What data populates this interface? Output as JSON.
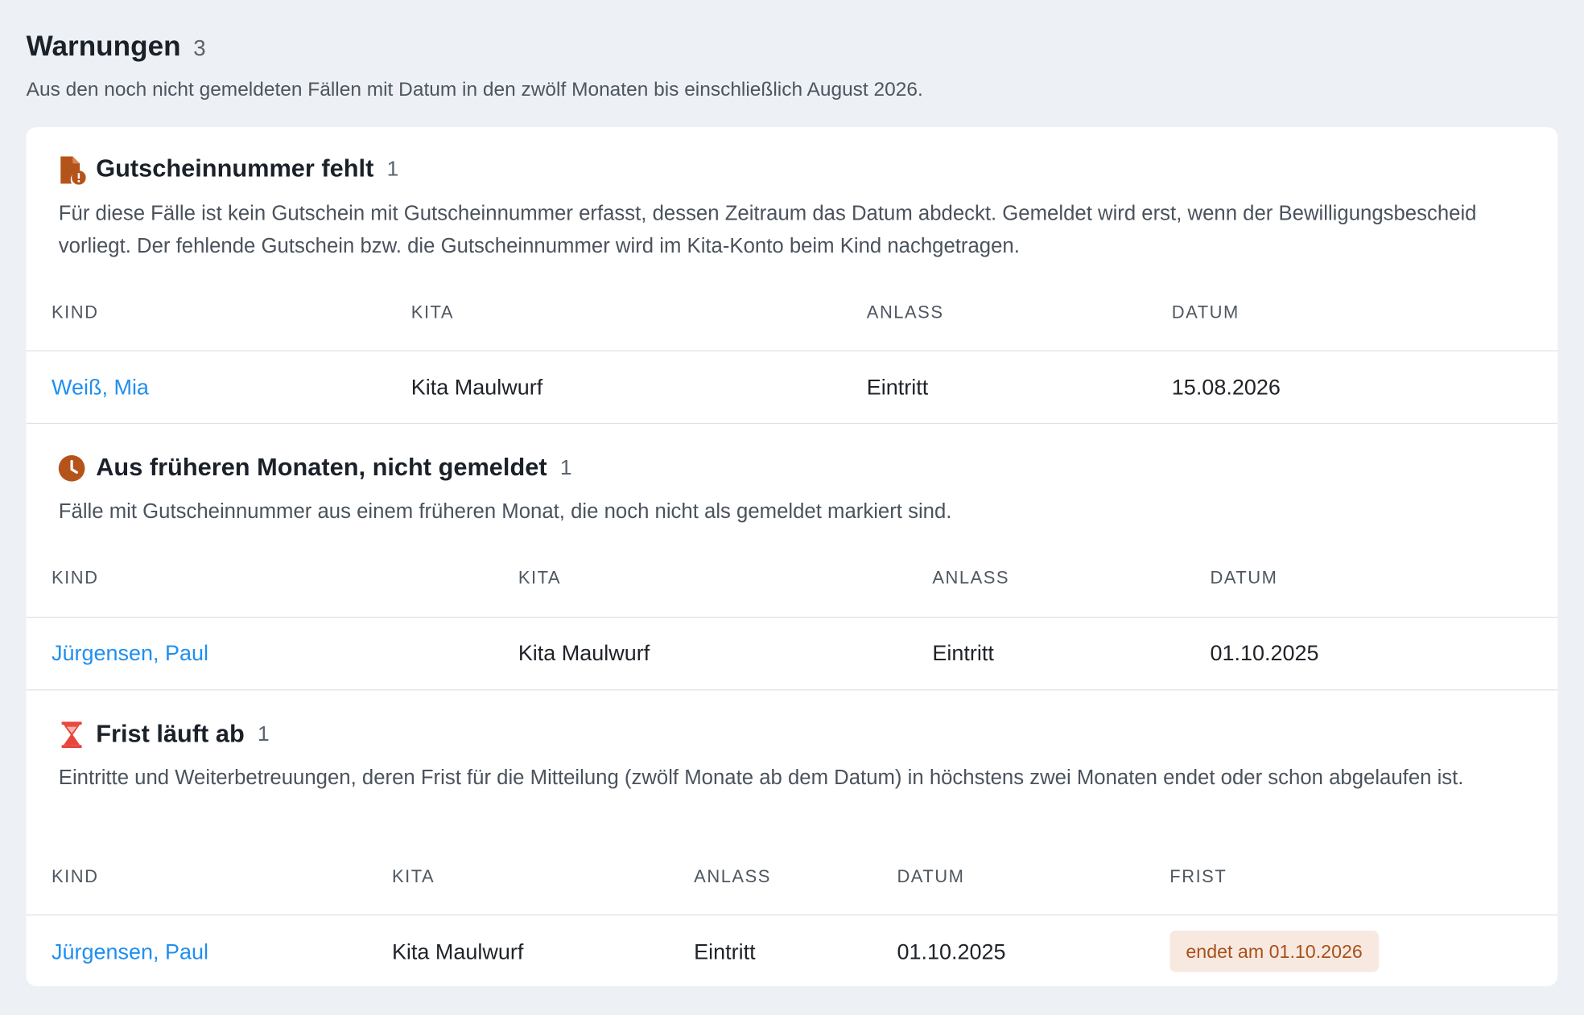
{
  "header": {
    "title": "Warnungen",
    "count": "3",
    "subtitle": "Aus den noch nicht gemeldeten Fällen mit Datum in den zwölf Monaten bis einschließlich August 2026."
  },
  "colors": {
    "link": "#1f8ff0",
    "warning_icon": "#b4541a",
    "expiry_icon": "#e8453c",
    "badge_bg": "#f8e9e0",
    "badge_text": "#a8501b"
  },
  "sections": [
    {
      "icon": "document-warning-icon",
      "title": "Gutscheinnummer fehlt",
      "count": "1",
      "description": "Für diese Fälle ist kein Gutschein mit Gutscheinnummer erfasst, dessen Zeitraum das Datum abdeckt. Gemeldet wird erst, wenn der Bewilligungsbescheid vorliegt. Der fehlende Gutschein bzw. die Gutscheinnummer wird im Kita-Konto beim Kind nachgetragen.",
      "columns": [
        "KIND",
        "KITA",
        "ANLASS",
        "DATUM"
      ],
      "rows": [
        {
          "kind": "Weiß, Mia",
          "kita": "Kita Maulwurf",
          "anlass": "Eintritt",
          "datum": "15.08.2026"
        }
      ]
    },
    {
      "icon": "clock-icon",
      "title": "Aus früheren Monaten, nicht gemeldet",
      "count": "1",
      "description": "Fälle mit Gutscheinnummer aus einem früheren Monat, die noch nicht als gemeldet markiert sind.",
      "columns": [
        "KIND",
        "KITA",
        "ANLASS",
        "DATUM"
      ],
      "rows": [
        {
          "kind": "Jürgensen, Paul",
          "kita": "Kita Maulwurf",
          "anlass": "Eintritt",
          "datum": "01.10.2025"
        }
      ]
    },
    {
      "icon": "hourglass-icon",
      "title": "Frist läuft ab",
      "count": "1",
      "description": "Eintritte und Weiterbetreuungen, deren Frist für die Mitteilung (zwölf Monate ab dem Datum) in höchstens zwei Monaten endet oder schon abgelaufen ist.",
      "columns": [
        "KIND",
        "KITA",
        "ANLASS",
        "DATUM",
        "FRIST"
      ],
      "rows": [
        {
          "kind": "Jürgensen, Paul",
          "kita": "Kita Maulwurf",
          "anlass": "Eintritt",
          "datum": "01.10.2025",
          "frist": "endet am 01.10.2026"
        }
      ]
    }
  ]
}
